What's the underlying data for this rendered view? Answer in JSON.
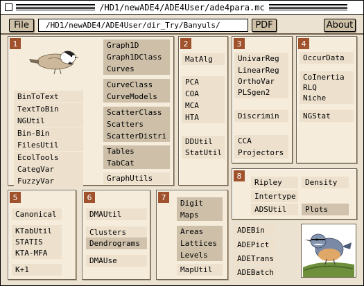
{
  "window": {
    "title": "/HD1/newADE4/ADE4User/ade4para.mc"
  },
  "toolbar": {
    "file_label": "File",
    "path_value": "/HD1/newADE4/ADE4User/dir_Try/Banyuls/",
    "pdf_label": "PDF",
    "about_label": "About"
  },
  "panels": {
    "p1": {
      "number": "1",
      "left_items": [
        "BinToText",
        "TextToBin",
        "NGUtil",
        "Bin-Bin",
        "FilesUtil",
        "EcolTools",
        "CategVar",
        "FuzzyVar"
      ],
      "groups": [
        [
          "Graph1D",
          "Graph1DClass",
          "Curves"
        ],
        [
          "CurveClass",
          "CurveModels"
        ],
        [
          "ScatterClass",
          "Scatters",
          "ScatterDistri"
        ],
        [
          "Tables",
          "TabCat"
        ],
        [
          "GraphUtils"
        ]
      ]
    },
    "p2": {
      "number": "2",
      "items": [
        "MatAlg",
        "PCA",
        "COA",
        "MCA",
        "HTA",
        "DDUtil",
        "StatUtil"
      ]
    },
    "p3": {
      "number": "3",
      "items": [
        "UnivarReg",
        "LinearReg",
        "OrthoVar",
        "PLSgen2",
        "Discrimin",
        "CCA",
        "Projectors"
      ]
    },
    "p4": {
      "number": "4",
      "items": [
        "OccurData",
        "CoInertia",
        "RLQ",
        "Niche",
        "NGStat"
      ]
    },
    "p5": {
      "number": "5",
      "items": [
        "Canonical",
        "KTabUtil",
        "STATIS",
        "KTA-MFA",
        "K+1"
      ]
    },
    "p6": {
      "number": "6",
      "items": [
        "DMAUtil",
        "Clusters",
        "Dendrograms",
        "DMAUse"
      ]
    },
    "p7": {
      "number": "7",
      "items": [
        "Digit",
        "Maps",
        "Areas",
        "Lattices",
        "Levels",
        "MapUtil"
      ]
    },
    "p8": {
      "number": "8",
      "items": [
        "Ripley",
        "Density",
        "Intertype",
        "ADSUtil",
        "Plots"
      ]
    },
    "extras": {
      "items": [
        "ADEBin",
        "ADEPict",
        "ADETrans",
        "ADEBatch"
      ]
    }
  },
  "icons": {
    "close": "close-box-icon",
    "bird1": "chickadee-icon",
    "bird2": "nuthatch-icon"
  },
  "colors": {
    "panel_number_bg": "#a0522d",
    "panel_bg": "#f5ecdb",
    "window_bg": "#ece2d2"
  }
}
